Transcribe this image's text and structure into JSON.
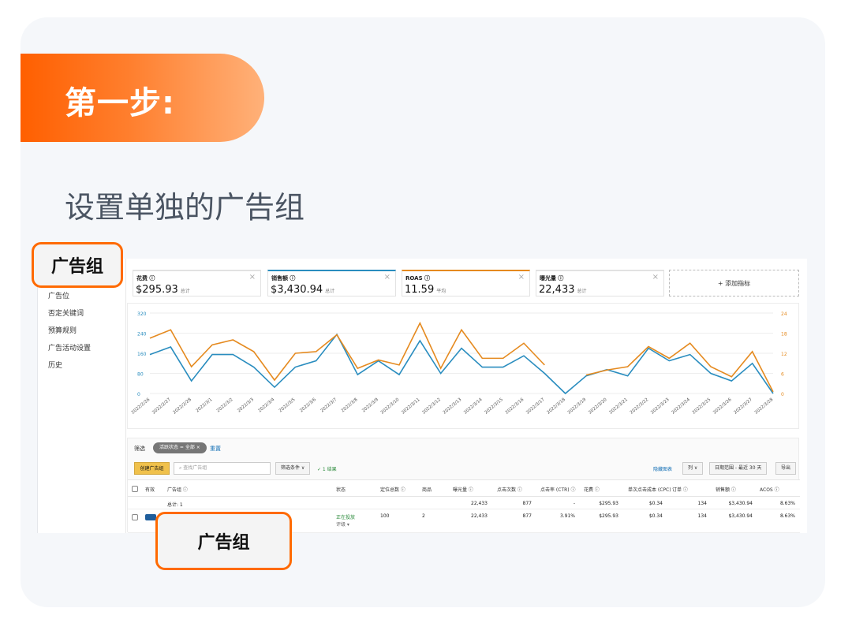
{
  "banner": {
    "title": "第一步:"
  },
  "subtitle": "设置单独的广告组",
  "highlight_top": "广告组",
  "highlight_bottom": "广告组",
  "sidenav": {
    "items": [
      "广告位",
      "否定关键词",
      "预算规则",
      "广告活动设置",
      "历史"
    ]
  },
  "metrics": [
    {
      "label": "花费 ⓘ",
      "value": "$295.93",
      "unit": "总计",
      "top_color": "#e2e2e2"
    },
    {
      "label": "销售额 ⓘ",
      "value": "$3,430.94",
      "unit": "总计",
      "top_color": "#2a8dbf"
    },
    {
      "label": "ROAS ⓘ",
      "value": "11.59",
      "unit": "平均",
      "top_color": "#e58a1f"
    },
    {
      "label": "曝光量 ⓘ",
      "value": "22,433",
      "unit": "总计",
      "top_color": "#e2e2e2"
    }
  ],
  "add_metric": "+ 添加指标",
  "chart_data": {
    "type": "line",
    "x": [
      "2022/2/26",
      "2022/2/27",
      "2022/2/28",
      "2022/3/1",
      "2022/3/2",
      "2022/3/3",
      "2022/3/4",
      "2022/3/5",
      "2022/3/6",
      "2022/3/7",
      "2022/3/8",
      "2022/3/9",
      "2022/3/10",
      "2022/3/11",
      "2022/3/12",
      "2022/3/13",
      "2022/3/14",
      "2022/3/15",
      "2022/3/16",
      "2022/3/17",
      "2022/3/18",
      "2022/3/19",
      "2022/3/20",
      "2022/3/21",
      "2022/3/22",
      "2022/3/23",
      "2022/3/24",
      "2022/3/25",
      "2022/3/26",
      "2022/3/27",
      "2022/3/28"
    ],
    "left_axis": {
      "ticks": [
        "0",
        "80",
        "160",
        "240",
        "320"
      ],
      "ylim": [
        0,
        320
      ],
      "color": "#2a8dbf"
    },
    "right_axis": {
      "ticks": [
        "0",
        "6",
        "12",
        "18",
        "24"
      ],
      "ylim": [
        0,
        24
      ],
      "color": "#e58a1f"
    },
    "series": [
      {
        "color": "#2a8dbf",
        "axis": "left",
        "values": [
          155,
          185,
          50,
          155,
          155,
          105,
          25,
          105,
          130,
          235,
          75,
          130,
          75,
          210,
          80,
          180,
          105,
          105,
          150,
          80,
          0,
          70,
          95,
          70,
          180,
          130,
          155,
          80,
          50,
          120,
          0
        ]
      },
      {
        "color": "#e58a1f",
        "axis": "right",
        "values": [
          16.5,
          19,
          8,
          14.5,
          16,
          12.5,
          4,
          12,
          12.5,
          17.5,
          7.5,
          10,
          8.5,
          21,
          7.5,
          19,
          10.5,
          10.5,
          15,
          8.5,
          null,
          5.5,
          7,
          8,
          14,
          10.5,
          15,
          8,
          5,
          12.5,
          0.5
        ]
      }
    ]
  },
  "filter": {
    "label": "筛选",
    "chip": "活跃状态 = 全部 ×",
    "reset": "重置"
  },
  "toolbar": {
    "create": "创建广告组",
    "search_placeholder": "查找广告组",
    "filter_cond": "筛选条件 ∨",
    "result": "✓ 1 结果",
    "hide_chart": "隐藏图表",
    "columns": "列 ∨",
    "date_range": "日期范围 - 最近 30 天",
    "export": "导出"
  },
  "table": {
    "headers": [
      "有效",
      "广告组 ⓘ",
      "状态",
      "定位总数 ⓘ",
      "商品",
      "曝光量 ⓘ",
      "点击次数 ⓘ",
      "点击率 (CTR) ⓘ",
      "花费 ⓘ",
      "单次点击成本 (CPC) ⓘ",
      "订单 ⓘ",
      "销售额 ⓘ",
      "ACOS ⓘ"
    ],
    "total_label": "总计: 1",
    "totals": [
      "22,433",
      "877",
      "-",
      "$295.93",
      "$0.34",
      "134",
      "$3,430.94",
      "8.63%"
    ],
    "row": {
      "status": "正在投放",
      "status_sub": "评级 ▾",
      "targets": "100",
      "products": "2",
      "values": [
        "22,433",
        "877",
        "3.91%",
        "$295.93",
        "$0.34",
        "134",
        "$3,430.94",
        "8.63%"
      ]
    }
  }
}
